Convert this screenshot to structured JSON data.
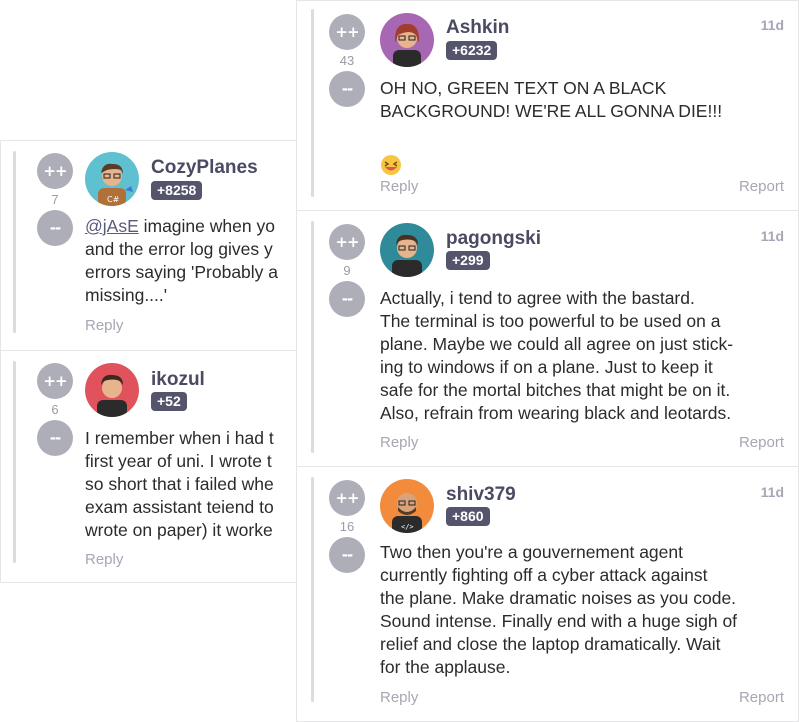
{
  "comments": {
    "cozyplanes": {
      "votes": "7",
      "username": "CozyPlanes",
      "rep": "+8258",
      "mention": "@jAsE",
      "line1": " imagine when yo",
      "line2": "and the error log gives y",
      "line3": "errors saying 'Probably a",
      "line4": "missing....'",
      "reply": "Reply"
    },
    "ikozul": {
      "votes": "6",
      "username": "ikozul",
      "rep": "+52",
      "line1": "I remember when i had t",
      "line2": "first year of uni. I wrote t",
      "line3": "so short that i failed whe",
      "line4": "exam assistant teiend to",
      "line5": "wrote on paper) it worke",
      "reply": "Reply"
    },
    "ashkin": {
      "votes": "43",
      "username": "Ashkin",
      "rep": "+6232",
      "time": "11d",
      "line1": "OH NO, GREEN TEXT ON A BLACK",
      "line2": "BACKGROUND! WE'RE ALL GONNA DIE!!!",
      "reply": "Reply",
      "report": "Report"
    },
    "pagongski": {
      "votes": "9",
      "username": "pagongski",
      "rep": "+299",
      "time": "11d",
      "line1": "Actually, i tend to agree with the bastard.",
      "line2": "The terminal is too powerful to be used on a",
      "line3": "plane. Maybe we could all agree on just stick-",
      "line4": "ing to windows if on a plane. Just to keep it",
      "line5": "safe for the mortal bitches that might be on it.",
      "line6": "Also, refrain from wearing black and leotards.",
      "reply": "Reply",
      "report": "Report"
    },
    "shiv379": {
      "votes": "16",
      "username": "shiv379",
      "rep": "+860",
      "time": "11d",
      "line1": "Two then you're a gouvernement agent",
      "line2": "currently fighting off a cyber attack against",
      "line3": "the plane. Make dramatic noises as you code.",
      "line4": "Sound intense. Finally end with a huge sigh of",
      "line5": "relief and close the laptop dramatically. Wait",
      "line6": "for the applause.",
      "reply": "Reply",
      "report": "Report"
    }
  },
  "vote_up_label": "++",
  "vote_down_label": "--",
  "colors": {
    "vote_button": "#aeaeb8",
    "rep_badge": "#54546d",
    "username": "#4a4a63",
    "meta": "#a6a6b4"
  }
}
